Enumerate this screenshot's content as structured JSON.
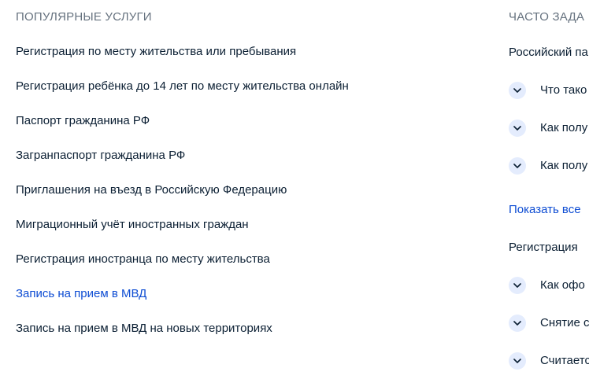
{
  "popular": {
    "heading": "ПОПУЛЯРНЫЕ УСЛУГИ",
    "items": [
      {
        "label": "Регистрация по месту жительства или пребывания"
      },
      {
        "label": "Регистрация ребёнка до 14 лет по месту жительства онлайн"
      },
      {
        "label": "Паспорт гражданина РФ"
      },
      {
        "label": "Загранпаспорт гражданина РФ"
      },
      {
        "label": "Приглашения на въезд в Российскую Федерацию"
      },
      {
        "label": "Миграционный учёт иностранных граждан"
      },
      {
        "label": "Регистрация иностранца по месту жительства"
      },
      {
        "label": "Запись на прием в МВД"
      },
      {
        "label": "Запись на прием в МВД на новых территориях"
      }
    ]
  },
  "faq": {
    "heading": "ЧАСТО ЗАДА",
    "groups": [
      {
        "title": "Российский па",
        "questions": [
          {
            "label": "Что тако"
          },
          {
            "label": "Как полу"
          },
          {
            "label": "Как полу"
          }
        ]
      },
      {
        "title": "Регистрация",
        "questions": [
          {
            "label": "Как офо"
          },
          {
            "label": "Снятие с"
          },
          {
            "label": "Считаетс"
          }
        ]
      }
    ],
    "show_all": "Показать все"
  },
  "colors": {
    "text": "#0b1f33",
    "muted": "#66727f",
    "link": "#0d4cd3",
    "chevron_bg": "#e4ecfd"
  }
}
